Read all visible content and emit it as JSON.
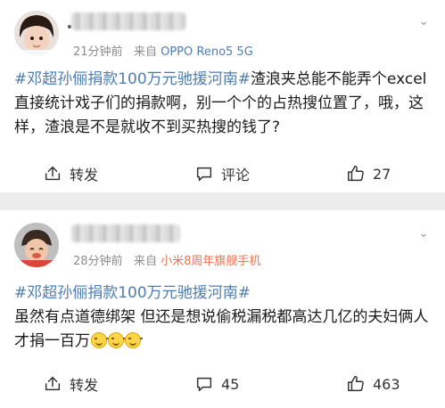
{
  "posts": [
    {
      "time": "21分钟前",
      "from_prefix": "来自",
      "device": "OPPO Reno5 5G",
      "hashtag": "#邓超孙俪捐款100万元驰援河南#",
      "text": "渣浪夹总能不能弄个excel直接统计戏子们的捐款啊，别一个个的占热搜位置了，哦，这样，渣浪是不是就收不到买热搜的钱了?",
      "share_label": "转发",
      "comment_label": "评论",
      "like_count": "27"
    },
    {
      "time": "28分钟前",
      "from_prefix": "来自",
      "device": "小米8周年旗舰手机",
      "hashtag": "#邓超孙俪捐款100万元驰援河南#",
      "text": "虽然有点道德绑架 但还是想说偷税漏税都高达几亿的夫妇俩人才捐一百万",
      "share_label": "转发",
      "comment_count": "45",
      "like_count": "463"
    }
  ],
  "icons": {
    "share": "share-icon",
    "comment": "comment-icon",
    "like": "thumbs-up-icon",
    "more": "chevron-down-icon",
    "emoji": "sweat-smile-emoji-icon"
  },
  "colors": {
    "link": "#507daf",
    "device_highlight": "#eb7350",
    "meta": "#8c8c8c",
    "divider": "#ececec"
  }
}
